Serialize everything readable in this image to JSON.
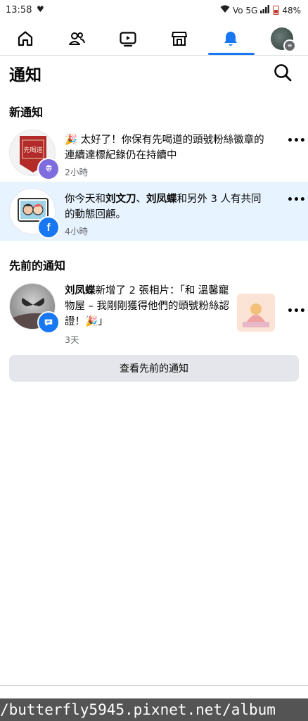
{
  "status_bar": {
    "time": "13:58",
    "heart_icon": "heart-pulse-icon",
    "network_text": "Vo 5G",
    "battery": "48%"
  },
  "nav": {
    "items": [
      {
        "icon": "home-icon"
      },
      {
        "icon": "friends-icon"
      },
      {
        "icon": "video-icon"
      },
      {
        "icon": "marketplace-icon"
      },
      {
        "icon": "bell-icon",
        "active": true
      },
      {
        "icon": "profile-avatar"
      }
    ],
    "accent_color": "#1877f2"
  },
  "header": {
    "title": "通知",
    "search_icon": "search-icon"
  },
  "sections": {
    "new_title": "新通知",
    "earlier_title": "先前的通知"
  },
  "notifications": [
    {
      "emoji": "🎉",
      "text": " 太好了！你保有先喝道的頭號粉絲徽章的連續達標紀錄仍在持續中",
      "time": "2小時",
      "avatar_text": "先喝道",
      "badge_icon": "gem-icon",
      "badge_color": "#7e6bde",
      "unread": false
    },
    {
      "text_pre": "你今天和",
      "name1": "刘文刀",
      "sep": "、",
      "name2": "刘凤蝶",
      "text_post": "和另外 3 人有共同的動態回顧。",
      "time": "4小時",
      "badge_icon": "facebook-icon",
      "badge_color": "#1877f2",
      "unread": true
    },
    {
      "name": "刘凤蝶",
      "text": "新增了 2 張相片：「和 溫馨寵物屋 – 我剛剛獲得他們的頭號粉絲認證！",
      "emoji": "🎉",
      "text_end": "」",
      "time": "3天",
      "badge_icon": "comment-icon",
      "badge_color": "#1877f2",
      "unread": false
    }
  ],
  "see_previous_label": "查看先前的通知",
  "watermark": "/butterfly5945.pixnet.net/album"
}
